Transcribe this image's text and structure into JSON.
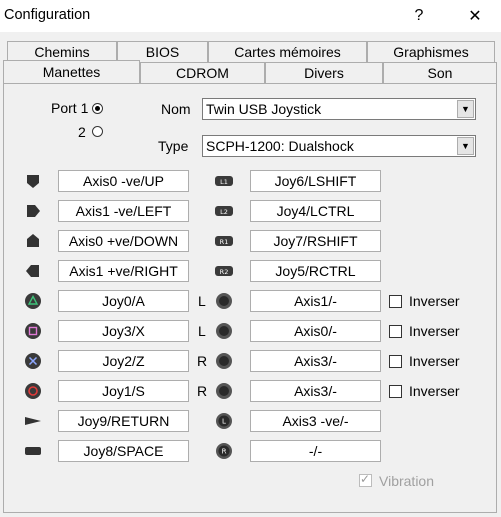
{
  "window": {
    "title": "Configuration",
    "help_glyph": "?",
    "close_glyph": "✕"
  },
  "tabs_row_back": [
    "Chemins",
    "BIOS",
    "Cartes mémoires",
    "Graphismes"
  ],
  "tabs_row_front": [
    "Manettes",
    "CDROM",
    "Divers",
    "Son"
  ],
  "active_tab": "Manettes",
  "ports": {
    "port1_label": "Port 1",
    "port2_label": "2",
    "selected": "Port 1"
  },
  "nom": {
    "label": "Nom",
    "value": "Twin USB Joystick"
  },
  "type": {
    "label": "Type",
    "value": "SCPH-1200: Dualshock"
  },
  "left_bindings": [
    {
      "icon": "dpad-up-icon",
      "value": "Axis0 -ve/UP"
    },
    {
      "icon": "dpad-left-icon",
      "value": "Axis1 -ve/LEFT"
    },
    {
      "icon": "dpad-down-icon",
      "value": "Axis0 +ve/DOWN"
    },
    {
      "icon": "dpad-right-icon",
      "value": "Axis1 +ve/RIGHT"
    },
    {
      "icon": "triangle-button-icon",
      "value": "Joy0/A"
    },
    {
      "icon": "square-button-icon",
      "value": "Joy3/X"
    },
    {
      "icon": "cross-button-icon",
      "value": "Joy2/Z"
    },
    {
      "icon": "circle-button-icon",
      "value": "Joy1/S"
    },
    {
      "icon": "start-button-icon",
      "value": "Joy9/RETURN"
    },
    {
      "icon": "select-button-icon",
      "value": "Joy8/SPACE"
    }
  ],
  "right_bindings": [
    {
      "icon": "l1-button-icon",
      "icon_text": "L1",
      "prefix": "",
      "value": "Joy6/LSHIFT"
    },
    {
      "icon": "l2-button-icon",
      "icon_text": "L2",
      "prefix": "",
      "value": "Joy4/LCTRL"
    },
    {
      "icon": "r1-button-icon",
      "icon_text": "R1",
      "prefix": "",
      "value": "Joy7/RSHIFT"
    },
    {
      "icon": "r2-button-icon",
      "icon_text": "R2",
      "prefix": "",
      "value": "Joy5/RCTRL"
    },
    {
      "icon": "analog-stick-icon",
      "icon_text": "",
      "prefix": "L",
      "value": "Axis1/-"
    },
    {
      "icon": "analog-stick-icon",
      "icon_text": "",
      "prefix": "L",
      "value": "Axis0/-"
    },
    {
      "icon": "analog-stick-icon",
      "icon_text": "",
      "prefix": "R",
      "value": "Axis3/-"
    },
    {
      "icon": "analog-stick-icon",
      "icon_text": "",
      "prefix": "R",
      "value": "Axis3/-"
    },
    {
      "icon": "l3-button-icon",
      "icon_text": "L",
      "prefix": "",
      "value": "Axis3 -ve/-"
    },
    {
      "icon": "r3-button-icon",
      "icon_text": "R",
      "prefix": "",
      "value": "-/-"
    }
  ],
  "invert_label": "Inverser",
  "vibration_label": "Vibration"
}
